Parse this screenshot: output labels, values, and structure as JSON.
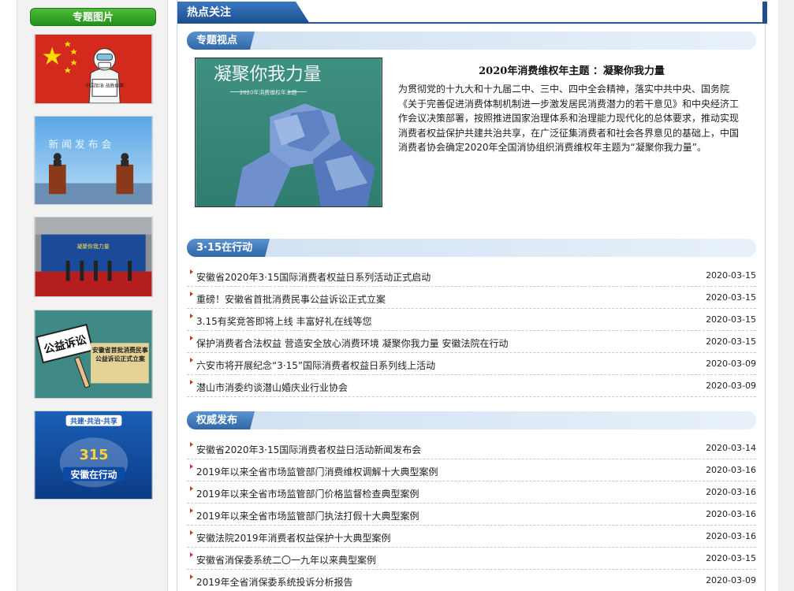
{
  "sidebar": {
    "title": "专题图片",
    "thumbs": [
      {
        "name": "抗疫主题图片",
        "caption": "中国加油 战胜疫情"
      },
      {
        "name": "新闻发布会图片",
        "caption": "新 闻 发 布 会"
      },
      {
        "name": "启动仪式图片",
        "caption": "凝聚你我力量"
      },
      {
        "name": "公益诉讼图片",
        "caption": "公益诉讼",
        "caption2": "安徽省首批消费民事公益诉讼正式立案"
      },
      {
        "name": "安徽在行动图片",
        "caption": "共建·共治·共享",
        "caption2": "安徽在行动",
        "badge": "315"
      }
    ]
  },
  "main": {
    "header": "热点关注",
    "feature": {
      "section": "专题视点",
      "image_title": "凝聚你我力量",
      "image_subtitle": "2020年消费维权年主题",
      "title": "2020年消费维权年主题 ：凝聚你我力量",
      "text": "为贯彻党的十九大和十九届二中、三中、四中全会精神，落实中共中央、国务院《关于完善促进消费体制机制进一步激发居民消费潜力的若干意见》和中央经济工作会议决策部署，按照推进国家治理体系和治理能力现代化的总体要求，推动实现消费者权益保护共建共治共享，在广泛征集消费者和社会各界意见的基础上，中国消费者协会确定2020年全国消协组织消费维权年主题为“凝聚你我力量”。"
    },
    "action": {
      "section": "3·15在行动",
      "items": [
        {
          "title": "安徽省2020年3·15国际消费者权益日系列活动正式启动",
          "date": "2020-03-15"
        },
        {
          "title": "重磅！安徽省首批消费民事公益诉讼正式立案",
          "date": "2020-03-15"
        },
        {
          "title": "3.15有奖竞答即将上线 丰富好礼在线等您",
          "date": "2020-03-15"
        },
        {
          "title": "保护消费者合法权益 营造安全放心消费环境 凝聚你我力量 安徽法院在行动",
          "date": "2020-03-15"
        },
        {
          "title": "六安市将开展纪念“3·15”国际消费者权益日系列线上活动",
          "date": "2020-03-09"
        },
        {
          "title": "潜山市消委约谈潜山婚庆业行业协会",
          "date": "2020-03-09"
        }
      ]
    },
    "release": {
      "section": "权威发布",
      "items": [
        {
          "title": "安徽省2020年3·15国际消费者权益日活动新闻发布会",
          "date": "2020-03-14"
        },
        {
          "title": "2019年以来全省市场监管部门消费维权调解十大典型案例",
          "date": "2020-03-16"
        },
        {
          "title": "2019年以来全省市场监管部门价格监督检查典型案例",
          "date": "2020-03-16"
        },
        {
          "title": "2019年以来全省市场监管部门执法打假十大典型案例",
          "date": "2020-03-16"
        },
        {
          "title": "安徽法院2019年消费者权益保护十大典型案例",
          "date": "2020-03-16"
        },
        {
          "title": "安徽省消保委系统二〇一九年以来典型案例",
          "date": "2020-03-15"
        },
        {
          "title": "2019年全省消保委系统投诉分析报告",
          "date": "2020-03-09"
        }
      ]
    }
  },
  "colors": {
    "accent": "#1f5a99",
    "green": "#2a9a1f",
    "arrow": "#c0392b"
  }
}
